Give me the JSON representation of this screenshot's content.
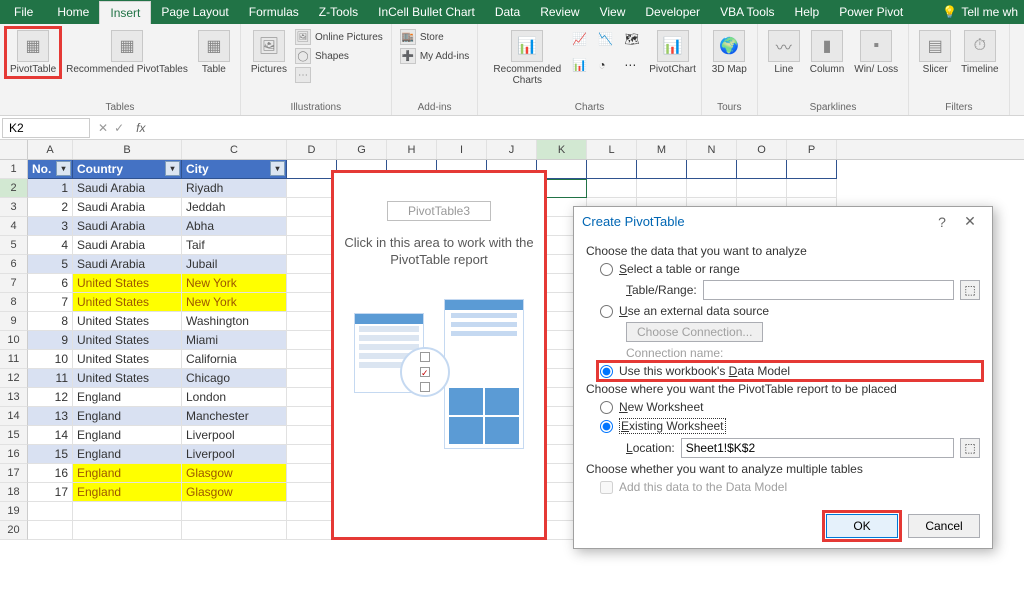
{
  "ribbon": {
    "tabs": [
      "File",
      "Home",
      "Insert",
      "Page Layout",
      "Formulas",
      "Z-Tools",
      "InCell Bullet Chart",
      "Data",
      "Review",
      "View",
      "Developer",
      "VBA Tools",
      "Help",
      "Power Pivot"
    ],
    "active_tab": "Insert",
    "tellme": "Tell me wh",
    "groups": {
      "tables": {
        "label": "Tables",
        "pivot": "PivotTable",
        "rec": "Recommended PivotTables",
        "table": "Table"
      },
      "illus": {
        "label": "Illustrations",
        "pictures": "Pictures",
        "online": "Online Pictures",
        "shapes": "Shapes",
        "more": "⋯"
      },
      "addins": {
        "label": "Add-ins",
        "store": "Store",
        "myaddins": "My Add-ins"
      },
      "charts": {
        "label": "Charts",
        "rec": "Recommended Charts",
        "pivotchart": "PivotChart"
      },
      "tours": {
        "label": "Tours",
        "map": "3D Map"
      },
      "spark": {
        "label": "Sparklines",
        "line": "Line",
        "col": "Column",
        "wl": "Win/ Loss"
      },
      "filters": {
        "label": "Filters",
        "slicer": "Slicer",
        "timeline": "Timeline"
      }
    }
  },
  "namebox": {
    "value": "K2",
    "fx": "fx"
  },
  "columns": [
    "A",
    "B",
    "C",
    "D",
    "G",
    "H",
    "I",
    "J",
    "K",
    "L",
    "M",
    "N",
    "O",
    "P"
  ],
  "table": {
    "headers": [
      "No.",
      "Country",
      "City"
    ],
    "rows": [
      {
        "n": 1,
        "country": "Saudi Arabia",
        "city": "Riyadh",
        "band": true
      },
      {
        "n": 2,
        "country": "Saudi Arabia",
        "city": "Jeddah",
        "band": false
      },
      {
        "n": 3,
        "country": "Saudi Arabia",
        "city": "Abha",
        "band": true
      },
      {
        "n": 4,
        "country": "Saudi Arabia",
        "city": "Taif",
        "band": false
      },
      {
        "n": 5,
        "country": "Saudi Arabia",
        "city": "Jubail",
        "band": true
      },
      {
        "n": 6,
        "country": "United States",
        "city": "New York",
        "yel": true
      },
      {
        "n": 7,
        "country": "United States",
        "city": "New York",
        "yel": true
      },
      {
        "n": 8,
        "country": "United States",
        "city": "Washington",
        "band": false
      },
      {
        "n": 9,
        "country": "United States",
        "city": "Miami",
        "band": true
      },
      {
        "n": 10,
        "country": "United States",
        "city": "California",
        "band": false
      },
      {
        "n": 11,
        "country": "United States",
        "city": "Chicago",
        "band": true
      },
      {
        "n": 12,
        "country": "England",
        "city": "London",
        "band": false
      },
      {
        "n": 13,
        "country": "England",
        "city": "Manchester",
        "band": true
      },
      {
        "n": 14,
        "country": "England",
        "city": "Liverpool",
        "band": false
      },
      {
        "n": 15,
        "country": "England",
        "city": "Liverpool",
        "band": true
      },
      {
        "n": 16,
        "country": "England",
        "city": "Glasgow",
        "yel": true
      },
      {
        "n": 17,
        "country": "England",
        "city": "Glasgow",
        "yel": true
      }
    ]
  },
  "pivot_placeholder": {
    "name": "PivotTable3",
    "msg": "Click in this area to work with the PivotTable report"
  },
  "dialog": {
    "title": "Create PivotTable",
    "section1": "Choose the data that you want to analyze",
    "opt_select": "Select a table or range",
    "table_range_label": "Table/Range:",
    "table_range_value": "",
    "opt_external": "Use an external data source",
    "choose_conn": "Choose Connection...",
    "conn_name_label": "Connection name:",
    "opt_datamodel": "Use this workbook's Data Model",
    "section2": "Choose where you want the PivotTable report to be placed",
    "opt_newws": "New Worksheet",
    "opt_existws": "Existing Worksheet",
    "location_label": "Location:",
    "location_value": "Sheet1!$K$2",
    "section3": "Choose whether you want to analyze multiple tables",
    "chk_add": "Add this data to the Data Model",
    "ok": "OK",
    "cancel": "Cancel"
  }
}
